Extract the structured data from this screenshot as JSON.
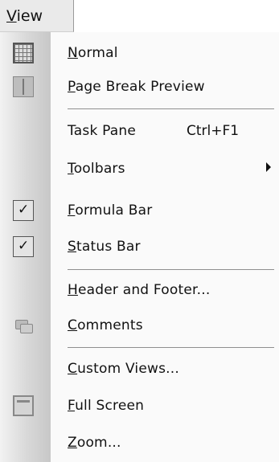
{
  "menubar": {
    "active_menu": "View"
  },
  "menu": {
    "items": [
      {
        "label": "Normal",
        "icon": "normal-view-grid-icon"
      },
      {
        "label": "Page Break Preview",
        "icon": "page-break-preview-icon"
      },
      {
        "label": "Task Pane",
        "shortcut": "Ctrl+F1"
      },
      {
        "label": "Toolbars",
        "submenu": true
      },
      {
        "label": "Formula Bar",
        "checked": true
      },
      {
        "label": "Status Bar",
        "checked": true
      },
      {
        "label": "Header and Footer..."
      },
      {
        "label": "Comments",
        "icon": "comments-icon"
      },
      {
        "label": "Custom Views..."
      },
      {
        "label": "Full Screen",
        "icon": "full-screen-icon"
      },
      {
        "label": "Zoom..."
      }
    ]
  }
}
